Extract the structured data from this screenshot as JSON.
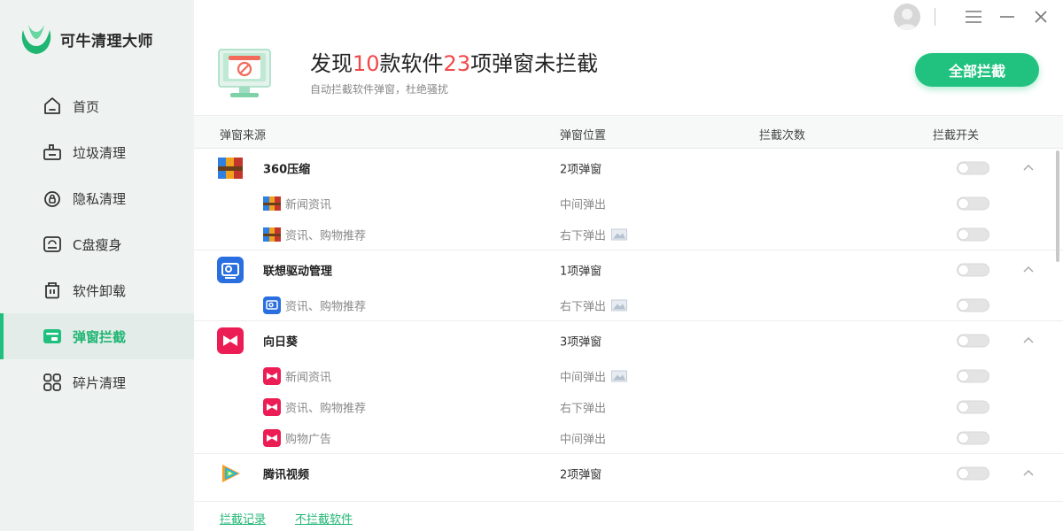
{
  "app": {
    "title": "可牛清理大师"
  },
  "sidebar": {
    "items": [
      {
        "label": "首页",
        "icon": "home-icon",
        "active": false
      },
      {
        "label": "垃圾清理",
        "icon": "trash-bag-icon",
        "active": false
      },
      {
        "label": "隐私清理",
        "icon": "lock-icon",
        "active": false
      },
      {
        "label": "C盘瘦身",
        "icon": "disk-icon",
        "active": false
      },
      {
        "label": "软件卸载",
        "icon": "uninstall-icon",
        "active": false
      },
      {
        "label": "弹窗拦截",
        "icon": "popup-icon",
        "active": true
      },
      {
        "label": "碎片清理",
        "icon": "grid-icon",
        "active": false
      }
    ]
  },
  "header": {
    "headline_pre": "发现",
    "software_count": "10",
    "headline_mid": "款软件",
    "popup_count": "23",
    "headline_post": "项弹窗未拦截",
    "subtitle": "自动拦截软件弹窗，杜绝骚扰",
    "block_all_label": "全部拦截"
  },
  "table": {
    "columns": [
      "弹窗来源",
      "弹窗位置",
      "拦截次数",
      "拦截开关"
    ],
    "groups": [
      {
        "name": "360压缩",
        "summary": "2项弹窗",
        "icon": "archive-icon",
        "subs": [
          {
            "name": "新闻资讯",
            "position": "中间弹出",
            "has_image": false
          },
          {
            "name": "资讯、购物推荐",
            "position": "右下弹出",
            "has_image": true
          }
        ]
      },
      {
        "name": "联想驱动管理",
        "summary": "1项弹窗",
        "icon": "driver-icon",
        "subs": [
          {
            "name": "资讯、购物推荐",
            "position": "右下弹出",
            "has_image": true
          }
        ]
      },
      {
        "name": "向日葵",
        "summary": "3项弹窗",
        "icon": "sunflower-icon",
        "subs": [
          {
            "name": "新闻资讯",
            "position": "中间弹出",
            "has_image": true
          },
          {
            "name": "资讯、购物推荐",
            "position": "右下弹出",
            "has_image": false
          },
          {
            "name": "购物广告",
            "position": "中间弹出",
            "has_image": false
          }
        ]
      },
      {
        "name": "腾讯视频",
        "summary": "2项弹窗",
        "icon": "video-icon",
        "subs": []
      }
    ]
  },
  "footer": {
    "block_log": "拦截记录",
    "no_block_software": "不拦截软件"
  },
  "colors": {
    "accent": "#21c27f",
    "highlight_number": "#f04848"
  }
}
